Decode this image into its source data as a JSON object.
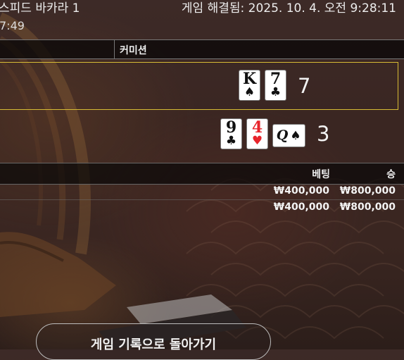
{
  "header": {
    "title": "스피드 바카라 1",
    "time": "7:49",
    "resolved": "게임 해결됨: 2025. 10. 4. 오전 9:28:11"
  },
  "tabs": {
    "commission": "커미션"
  },
  "hands": {
    "banker": {
      "cards": [
        {
          "rank": "K",
          "suit": "♠",
          "color": "#111111"
        },
        {
          "rank": "7",
          "suit": "♣",
          "color": "#111111"
        }
      ],
      "score": "7"
    },
    "player": {
      "cards": [
        {
          "rank": "9",
          "suit": "♣",
          "color": "#111111"
        },
        {
          "rank": "4",
          "suit": "♥",
          "color": "#e8242b"
        },
        {
          "rank": "Q",
          "suit": "♠",
          "color": "#111111",
          "rotated": true
        }
      ],
      "score": "3"
    }
  },
  "results_table": {
    "headers": {
      "bet": "베팅",
      "win": "승"
    },
    "rows": [
      {
        "bet": "₩400,000",
        "win": "₩800,000"
      },
      {
        "bet": "₩400,000",
        "win": "₩800,000"
      }
    ]
  },
  "footer": {
    "back_button": "게임 기록으로 돌아가기"
  },
  "colors": {
    "highlight_border": "#d6bb35",
    "background": "#3a2622",
    "red_suit": "#e8242b"
  }
}
